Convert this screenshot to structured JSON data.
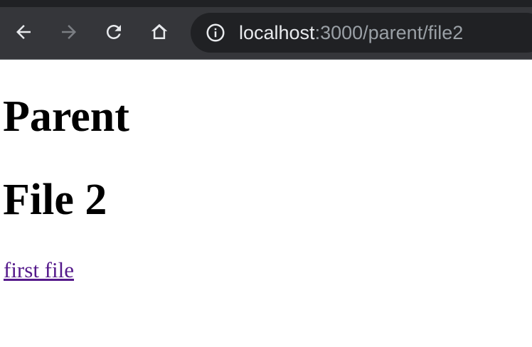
{
  "browser": {
    "url_host": "localhost",
    "url_path": ":3000/parent/file2",
    "icons": {
      "back": "arrow-left-icon",
      "forward": "arrow-right-icon",
      "reload": "reload-icon",
      "home": "home-icon",
      "site_info": "info-icon"
    },
    "colors": {
      "toolbar": "#35363a",
      "omnibox": "#202124"
    }
  },
  "page": {
    "heading_1": "Parent",
    "heading_2": "File 2",
    "link_text": "first file",
    "link_color": "#551a8b"
  }
}
